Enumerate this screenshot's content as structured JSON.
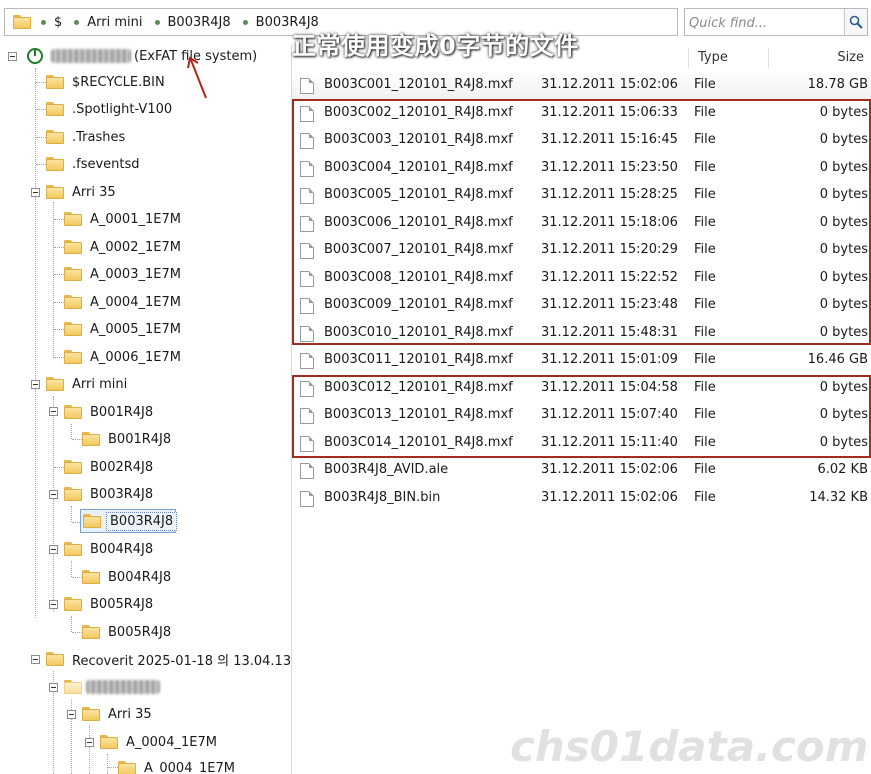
{
  "breadcrumb": {
    "items": [
      "$",
      "Arri mini",
      "B003R4J8",
      "B003R4J8"
    ]
  },
  "search": {
    "placeholder": "Quick find..."
  },
  "overlay": {
    "caption": "正常使用变成0字节的文件",
    "watermark": "chs01data.com"
  },
  "tree": {
    "drive_label": "(ExFAT file system)",
    "nodes": [
      {
        "label": "$RECYCLE.BIN"
      },
      {
        "label": ".Spotlight-V100"
      },
      {
        "label": ".Trashes"
      },
      {
        "label": ".fseventsd"
      },
      {
        "label": "Arri 35"
      },
      {
        "label": "A_0001_1E7M"
      },
      {
        "label": "A_0002_1E7M"
      },
      {
        "label": "A_0003_1E7M"
      },
      {
        "label": "A_0004_1E7M"
      },
      {
        "label": "A_0005_1E7M"
      },
      {
        "label": "A_0006_1E7M"
      },
      {
        "label": "Arri mini"
      },
      {
        "label": "B001R4J8"
      },
      {
        "label": "B001R4J8"
      },
      {
        "label": "B002R4J8"
      },
      {
        "label": "B003R4J8"
      },
      {
        "label": "B003R4J8"
      },
      {
        "label": "B004R4J8"
      },
      {
        "label": "B004R4J8"
      },
      {
        "label": "B005R4J8"
      },
      {
        "label": "B005R4J8"
      },
      {
        "label": "Recoverit 2025-01-18 의 13.04.13"
      },
      {
        "label": "Arri 35"
      },
      {
        "label": "A_0004_1E7M"
      },
      {
        "label": "A_0004_1E7M"
      }
    ]
  },
  "list": {
    "columns": {
      "type": "Type",
      "size": "Size"
    },
    "rows": [
      {
        "name": "B003C001_120101_R4J8.mxf",
        "date": "31.12.2011 15:02:06",
        "type": "File",
        "size": "18.78 GB"
      },
      {
        "name": "B003C002_120101_R4J8.mxf",
        "date": "31.12.2011 15:06:33",
        "type": "File",
        "size": "0 bytes"
      },
      {
        "name": "B003C003_120101_R4J8.mxf",
        "date": "31.12.2011 15:16:45",
        "type": "File",
        "size": "0 bytes"
      },
      {
        "name": "B003C004_120101_R4J8.mxf",
        "date": "31.12.2011 15:23:50",
        "type": "File",
        "size": "0 bytes"
      },
      {
        "name": "B003C005_120101_R4J8.mxf",
        "date": "31.12.2011 15:28:25",
        "type": "File",
        "size": "0 bytes"
      },
      {
        "name": "B003C006_120101_R4J8.mxf",
        "date": "31.12.2011 15:18:06",
        "type": "File",
        "size": "0 bytes"
      },
      {
        "name": "B003C007_120101_R4J8.mxf",
        "date": "31.12.2011 15:20:29",
        "type": "File",
        "size": "0 bytes"
      },
      {
        "name": "B003C008_120101_R4J8.mxf",
        "date": "31.12.2011 15:22:52",
        "type": "File",
        "size": "0 bytes"
      },
      {
        "name": "B003C009_120101_R4J8.mxf",
        "date": "31.12.2011 15:23:48",
        "type": "File",
        "size": "0 bytes"
      },
      {
        "name": "B003C010_120101_R4J8.mxf",
        "date": "31.12.2011 15:48:31",
        "type": "File",
        "size": "0 bytes"
      },
      {
        "name": "B003C011_120101_R4J8.mxf",
        "date": "31.12.2011 15:01:09",
        "type": "File",
        "size": "16.46 GB"
      },
      {
        "name": "B003C012_120101_R4J8.mxf",
        "date": "31.12.2011 15:04:58",
        "type": "File",
        "size": "0 bytes"
      },
      {
        "name": "B003C013_120101_R4J8.mxf",
        "date": "31.12.2011 15:07:40",
        "type": "File",
        "size": "0 bytes"
      },
      {
        "name": "B003C014_120101_R4J8.mxf",
        "date": "31.12.2011 15:11:40",
        "type": "File",
        "size": "0 bytes"
      },
      {
        "name": "B003R4J8_AVID.ale",
        "date": "31.12.2011 15:02:06",
        "type": "File",
        "size": "6.02 KB"
      },
      {
        "name": "B003R4J8_BIN.bin",
        "date": "31.12.2011 15:02:06",
        "type": "File",
        "size": "14.32 KB"
      }
    ]
  },
  "colors": {
    "highlight_border": "#a42b1f",
    "folder": "#f3c95e",
    "selected_bg": "#e9f0fa"
  },
  "icons": {
    "folder": "folder-icon",
    "file": "file-icon",
    "search": "search-icon",
    "disk": "drive-icon",
    "expand": "collapse-toggle-icon"
  }
}
